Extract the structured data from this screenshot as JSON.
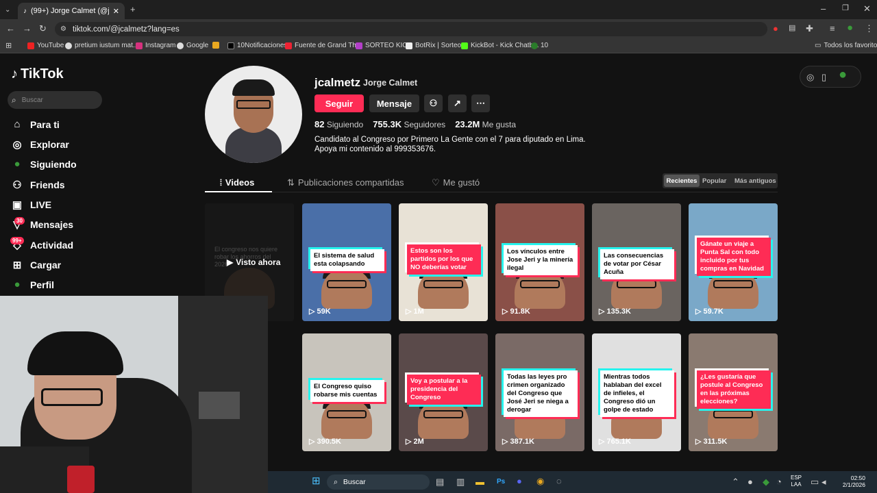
{
  "browser": {
    "tab_title": "(99+) Jorge Calmet (@jcalmetz",
    "url": "tiktok.com/@jcalmetz?lang=es",
    "bookmarks": [
      "YouTube",
      "pretium iustum mat...",
      "Instagram",
      "Google",
      "10Notificaciones",
      "Fuente de Grand Th...",
      "SORTEO KICK",
      "BotRix | Sorteos",
      "KickBot - Kick Chatb...",
      "10"
    ],
    "all_bookmarks": "Todos los favoritos"
  },
  "sidebar": {
    "logo": "TikTok",
    "search_placeholder": "Buscar",
    "items": [
      {
        "label": "Para ti",
        "icon": "home-icon"
      },
      {
        "label": "Explorar",
        "icon": "compass-icon"
      },
      {
        "label": "Siguiendo",
        "icon": "following-icon"
      },
      {
        "label": "Friends",
        "icon": "friends-icon"
      },
      {
        "label": "LIVE",
        "icon": "live-icon"
      },
      {
        "label": "Mensajes",
        "icon": "messages-icon",
        "badge": "30"
      },
      {
        "label": "Actividad",
        "icon": "activity-icon",
        "badge": "99+"
      },
      {
        "label": "Cargar",
        "icon": "upload-icon"
      },
      {
        "label": "Perfil",
        "icon": "profile-icon"
      }
    ]
  },
  "profile": {
    "username": "jcalmetz",
    "display_name": "Jorge Calmet",
    "follow": "Seguir",
    "message": "Mensaje",
    "following_count": "82",
    "following_label": "Siguiendo",
    "followers_count": "755.3K",
    "followers_label": "Seguidores",
    "likes_count": "23.2M",
    "likes_label": "Me gusta",
    "bio_line1": "Candidato al Congreso por Primero La Gente con el 7 para diputado en Lima.",
    "bio_line2": "Apoya mi contenido al 999353676."
  },
  "tabs": [
    "Videos",
    "Publicaciones compartidas",
    "Me gustó"
  ],
  "sort": [
    "Recientes",
    "Popular",
    "Más antiguos"
  ],
  "videos_row1": [
    {
      "caption": "El congreso nos quiere robar los ahorros del 2026",
      "views": "",
      "overlay": "Visto ahora"
    },
    {
      "caption": "El sistema de salud esta colapsando",
      "views": "59K"
    },
    {
      "caption": "Estos son los partidos por los que NO deberías votar",
      "views": "1M"
    },
    {
      "caption": "Los vínculos entre Jose Jeri y la minería ilegal",
      "views": "91.8K"
    },
    {
      "caption": "Las consecuencias de votar por César Acuña",
      "views": "135.3K"
    },
    {
      "caption": "Gánate un viaje a Punta Sal con todo incluido por tus compras en Navidad",
      "views": "59.7K"
    }
  ],
  "videos_row2": [
    {
      "caption": "El Congreso quiso robarse mis cuentas",
      "views": "390.5K"
    },
    {
      "caption": "Voy a postular a la presidencia del Congreso",
      "views": "2M"
    },
    {
      "caption": "Todas las leyes pro crimen organizado del Congreso que José Jeri se niega a derogar",
      "views": "387.1K"
    },
    {
      "caption": "Mientras todos hablaban del excel de infieles, el Congreso dió un golpe de estado",
      "views": "765.1K"
    },
    {
      "caption": "¿Les gustaría que postule al Congreso en las próximas elecciones?",
      "views": "311.5K"
    }
  ],
  "taskbar": {
    "search": "Buscar",
    "lang": "ESP",
    "lang2": "LAA",
    "time": "02:50",
    "date": "2/1/2026"
  }
}
